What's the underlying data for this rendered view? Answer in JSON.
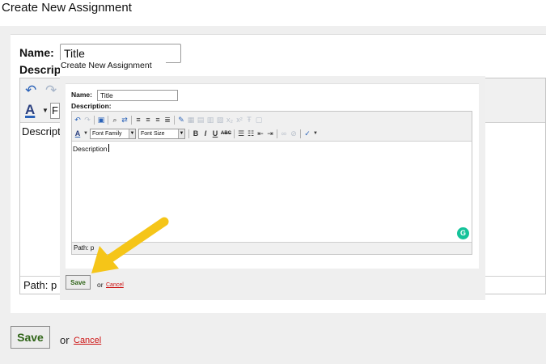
{
  "background": {
    "page_title": "Create New Assignment",
    "name_label": "Name:",
    "name_value": "Title",
    "description_label": "Description:",
    "font_family_visible": "F",
    "body_text": "Descript",
    "path_text": "Path: p",
    "save_label": "Save",
    "or_text": "or",
    "cancel_label": "Cancel"
  },
  "dialog": {
    "page_title": "Create New Assignment",
    "name_label": "Name:",
    "name_value": "Title",
    "description_label": "Description:",
    "font_family_select": "Font Family",
    "font_size_select": "Font Size",
    "bold_label": "B",
    "italic_label": "I",
    "underline_label": "U",
    "strike_label": "ABC",
    "body_text": "Description",
    "path_text": "Path: p",
    "save_label": "Save",
    "or_text": "or",
    "cancel_label": "Cancel"
  },
  "colors": {
    "save_text": "#2f6417",
    "cancel_link": "#cc1111",
    "annotation_arrow": "#f5c518",
    "grammarly": "#15c39a",
    "toolbar_blue": "#2a62b8"
  },
  "icons": {
    "undo": "undo-icon",
    "redo": "redo-icon",
    "paste": "paste-icon",
    "find": "find-icon",
    "replace": "replace-icon",
    "font_color": "font-color-icon",
    "grammarly": "grammarly-icon"
  }
}
